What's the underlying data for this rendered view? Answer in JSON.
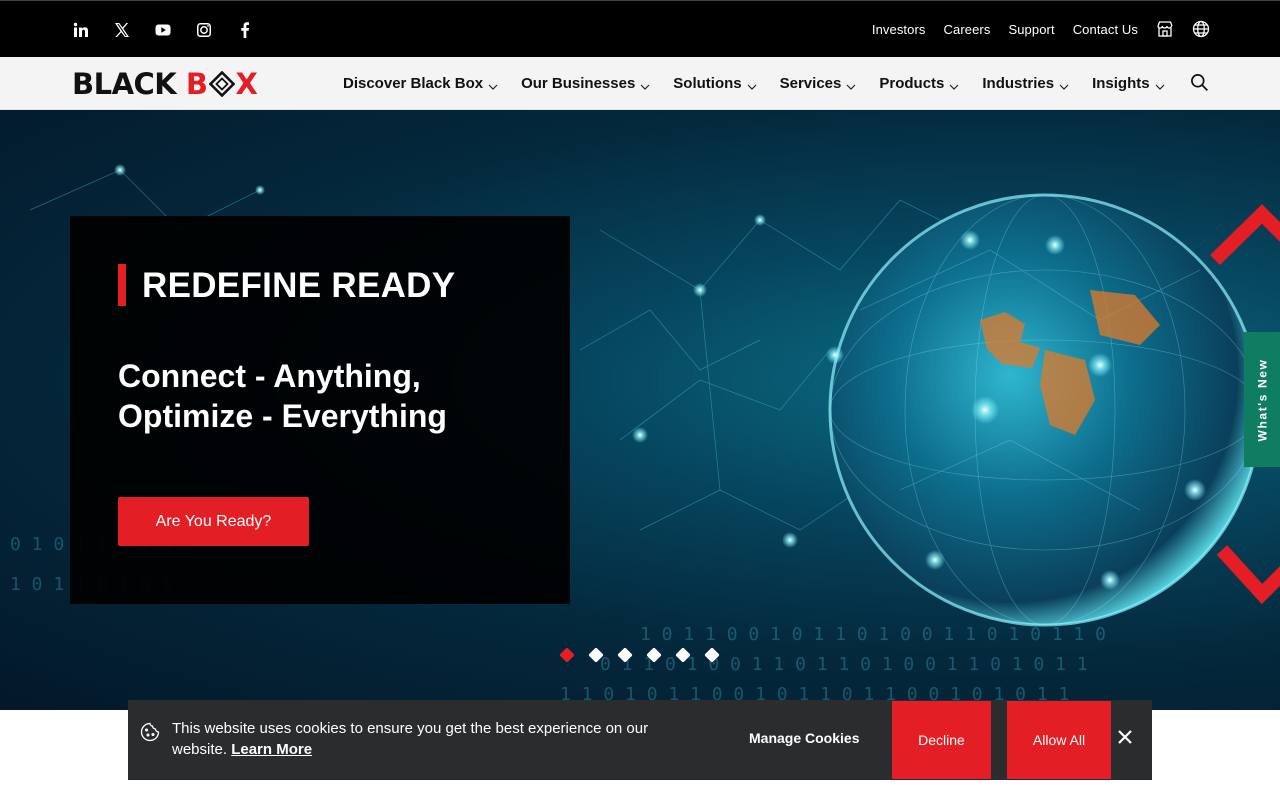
{
  "topbar": {
    "social": [
      {
        "icon": "linkedin-icon",
        "glyph": "in"
      },
      {
        "icon": "x-twitter-icon",
        "glyph": "X"
      },
      {
        "icon": "youtube-icon",
        "glyph": "▶"
      },
      {
        "icon": "instagram-icon",
        "glyph": "◎"
      },
      {
        "icon": "facebook-icon",
        "glyph": "f"
      }
    ],
    "links": [
      "Investors",
      "Careers",
      "Support",
      "Contact Us"
    ],
    "store_icon": "store-icon",
    "globe_icon": "globe-icon"
  },
  "logo": {
    "part1": "BLACK ",
    "part2": "B",
    "part3": "X"
  },
  "nav": {
    "items": [
      "Discover Black Box",
      "Our Businesses",
      "Solutions",
      "Services",
      "Products",
      "Industries",
      "Insights"
    ],
    "search_icon": "search-icon"
  },
  "hero": {
    "title": "REDEFINE READY",
    "subtitle_line1": "Connect - Anything,",
    "subtitle_line2": "Optimize - Everything",
    "cta": "Are You Ready?",
    "slides_total": 6,
    "active_slide": 1,
    "whats_new": "What's New"
  },
  "cookie": {
    "text": "This website uses cookies to ensure you get the best experience on our website.",
    "learn_more": "Learn More",
    "manage": "Manage Cookies",
    "decline": "Decline",
    "allow": "Allow All"
  },
  "colors": {
    "accent": "#e31e24",
    "whats_new": "#0f7d62",
    "cookie_bg": "#2b2c2e"
  }
}
